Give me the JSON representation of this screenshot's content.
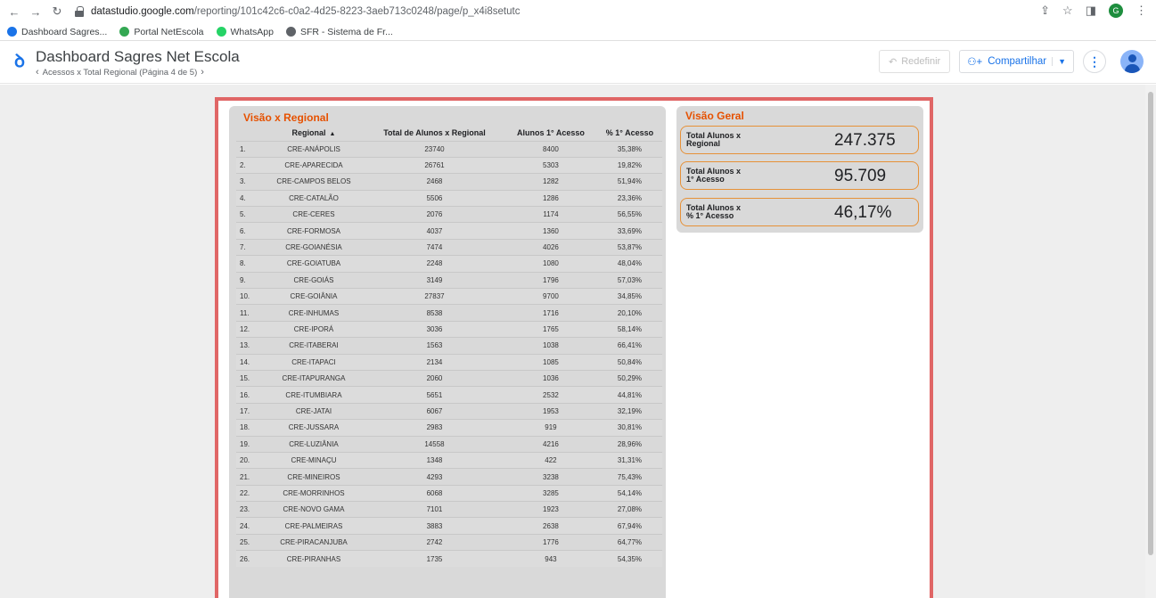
{
  "browser": {
    "back_icon": "back-arrow-icon",
    "forward_icon": "forward-arrow-icon",
    "reload_icon": "reload-icon",
    "url_host": "datastudio.google.com",
    "url_path": "/reporting/101c42c6-c0a2-4d25-8223-3aeb713c0248/page/p_x4i8setutc",
    "profile_initial": "G",
    "bookmarks": [
      {
        "label": "Dashboard Sagres...",
        "color": "#1a73e8"
      },
      {
        "label": "Portal NetEscola",
        "color": "#34a853"
      },
      {
        "label": "WhatsApp",
        "color": "#25d366"
      },
      {
        "label": "SFR - Sistema de Fr...",
        "color": "#5f6368"
      }
    ]
  },
  "header": {
    "title": "Dashboard Sagres Net Escola",
    "breadcrumb": "Acessos x Total Regional (Página 4 de 5)",
    "redefinir_label": "Redefinir",
    "share_label": "Compartilhar"
  },
  "table": {
    "title": "Visão x Regional",
    "columns": [
      "Regional",
      "Total de Alunos x Regional",
      "Alunos 1° Acesso",
      "% 1° Acesso"
    ],
    "rows": [
      [
        "1.",
        "CRE-ANÁPOLIS",
        "23740",
        "8400",
        "35,38%"
      ],
      [
        "2.",
        "CRE-APARECIDA",
        "26761",
        "5303",
        "19,82%"
      ],
      [
        "3.",
        "CRE-CAMPOS BELOS",
        "2468",
        "1282",
        "51,94%"
      ],
      [
        "4.",
        "CRE-CATALÃO",
        "5506",
        "1286",
        "23,36%"
      ],
      [
        "5.",
        "CRE-CERES",
        "2076",
        "1174",
        "56,55%"
      ],
      [
        "6.",
        "CRE-FORMOSA",
        "4037",
        "1360",
        "33,69%"
      ],
      [
        "7.",
        "CRE-GOIANÉSIA",
        "7474",
        "4026",
        "53,87%"
      ],
      [
        "8.",
        "CRE-GOIATUBA",
        "2248",
        "1080",
        "48,04%"
      ],
      [
        "9.",
        "CRE-GOIÁS",
        "3149",
        "1796",
        "57,03%"
      ],
      [
        "10.",
        "CRE-GOIÂNIA",
        "27837",
        "9700",
        "34,85%"
      ],
      [
        "11.",
        "CRE-INHUMAS",
        "8538",
        "1716",
        "20,10%"
      ],
      [
        "12.",
        "CRE-IPORÁ",
        "3036",
        "1765",
        "58,14%"
      ],
      [
        "13.",
        "CRE-ITABERAI",
        "1563",
        "1038",
        "66,41%"
      ],
      [
        "14.",
        "CRE-ITAPACI",
        "2134",
        "1085",
        "50,84%"
      ],
      [
        "15.",
        "CRE-ITAPURANGA",
        "2060",
        "1036",
        "50,29%"
      ],
      [
        "16.",
        "CRE-ITUMBIARA",
        "5651",
        "2532",
        "44,81%"
      ],
      [
        "17.",
        "CRE-JATAI",
        "6067",
        "1953",
        "32,19%"
      ],
      [
        "18.",
        "CRE-JUSSARA",
        "2983",
        "919",
        "30,81%"
      ],
      [
        "19.",
        "CRE-LUZIÂNIA",
        "14558",
        "4216",
        "28,96%"
      ],
      [
        "20.",
        "CRE-MINAÇU",
        "1348",
        "422",
        "31,31%"
      ],
      [
        "21.",
        "CRE-MINEIROS",
        "4293",
        "3238",
        "75,43%"
      ],
      [
        "22.",
        "CRE-MORRINHOS",
        "6068",
        "3285",
        "54,14%"
      ],
      [
        "23.",
        "CRE-NOVO GAMA",
        "7101",
        "1923",
        "27,08%"
      ],
      [
        "24.",
        "CRE-PALMEIRAS",
        "3883",
        "2638",
        "67,94%"
      ],
      [
        "25.",
        "CRE-PIRACANJUBA",
        "2742",
        "1776",
        "64,77%"
      ],
      [
        "26.",
        "CRE-PIRANHAS",
        "1735",
        "943",
        "54,35%"
      ]
    ]
  },
  "kpis": {
    "title": "Visão Geral",
    "items": [
      {
        "label_line1": "Total Alunos x",
        "label_line2": "Regional",
        "value": "247.375"
      },
      {
        "label_line1": "Total Alunos x",
        "label_line2": "1° Acesso",
        "value": "95.709"
      },
      {
        "label_line1": "Total Alunos x",
        "label_line2": "% 1° Acesso",
        "value": "46,17%"
      }
    ]
  },
  "colors": {
    "accent_orange": "#e65100",
    "report_border": "#e06666",
    "kpi_border": "#e69138",
    "brand_blue": "#1a73e8"
  }
}
